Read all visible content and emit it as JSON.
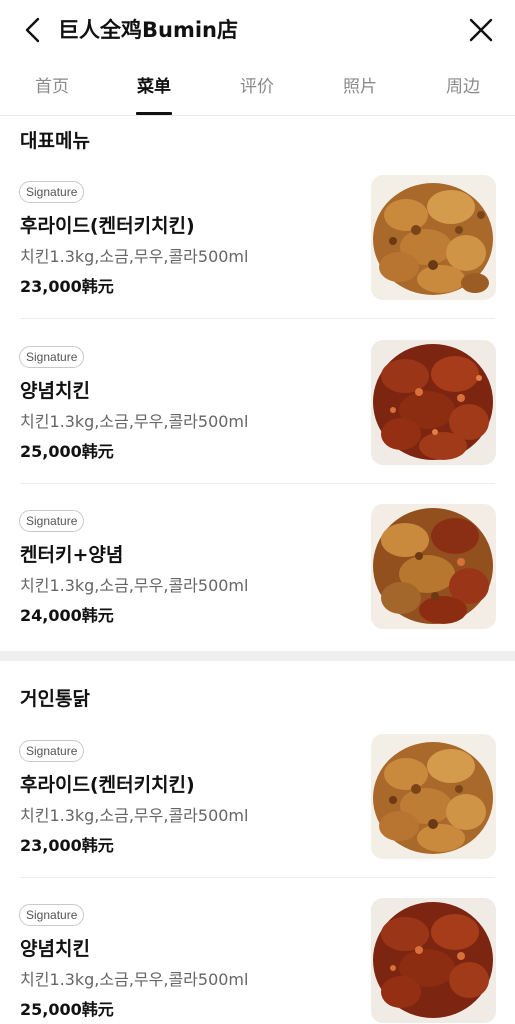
{
  "header": {
    "title": "巨人全鸡Bumin店"
  },
  "tabs": [
    {
      "label": "首页",
      "active": false
    },
    {
      "label": "菜单",
      "active": true
    },
    {
      "label": "评价",
      "active": false
    },
    {
      "label": "照片",
      "active": false
    },
    {
      "label": "周边",
      "active": false
    }
  ],
  "sections": [
    {
      "title": "대표메뉴",
      "items": [
        {
          "badge": "Signature",
          "name": "후라이드(켄터키치킨)",
          "desc": "치킨1.3kg,소금,무우,콜라500ml",
          "price": "23,000韩元",
          "image": "fried-chicken-photo"
        },
        {
          "badge": "Signature",
          "name": "양념치킨",
          "desc": "치킨1.3kg,소금,무우,콜라500ml",
          "price": "25,000韩元",
          "image": "seasoned-chicken-photo"
        },
        {
          "badge": "Signature",
          "name": "켄터키+양념",
          "desc": "치킨1.3kg,소금,무우,콜라500ml",
          "price": "24,000韩元",
          "image": "half-half-chicken-photo"
        }
      ]
    },
    {
      "title": "거인통닭",
      "items": [
        {
          "badge": "Signature",
          "name": "후라이드(켄터키치킨)",
          "desc": "치킨1.3kg,소금,무우,콜라500ml",
          "price": "23,000韩元",
          "image": "fried-chicken-photo"
        },
        {
          "badge": "Signature",
          "name": "양념치킨",
          "desc": "치킨1.3kg,소금,무우,콜라500ml",
          "price": "25,000韩元",
          "image": "seasoned-chicken-photo"
        }
      ]
    }
  ],
  "icons": {
    "back": "chevron-left-icon",
    "close": "close-icon"
  },
  "colors": {
    "active_tab": "#111111",
    "inactive_tab": "#8a8a8a",
    "fried_chicken": "#b8772e",
    "seasoned_chicken": "#8e2e12"
  }
}
